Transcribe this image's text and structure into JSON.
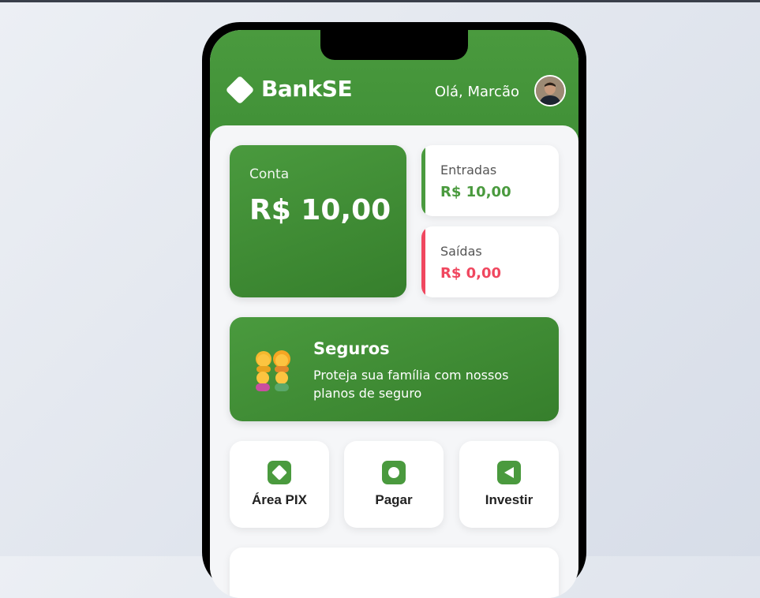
{
  "header": {
    "brand": "BankSE",
    "greeting": "Olá, Marcão",
    "brand_color": "#4a9a3e"
  },
  "balance": {
    "label": "Conta",
    "value": "R$ 10,00"
  },
  "income": {
    "label": "Entradas",
    "value": "R$ 10,00",
    "color": "#4a9a3e"
  },
  "expenses": {
    "label": "Saídas",
    "value": "R$ 0,00",
    "color": "#f0475f"
  },
  "insurance": {
    "title": "Seguros",
    "description": "Proteja sua família com nossos planos de seguro",
    "icon": "family-emoji-icon"
  },
  "actions": [
    {
      "label": "Área PIX",
      "icon": "pix-diamond-icon"
    },
    {
      "label": "Pagar",
      "icon": "circle-icon"
    },
    {
      "label": "Investir",
      "icon": "triangle-left-icon"
    }
  ]
}
